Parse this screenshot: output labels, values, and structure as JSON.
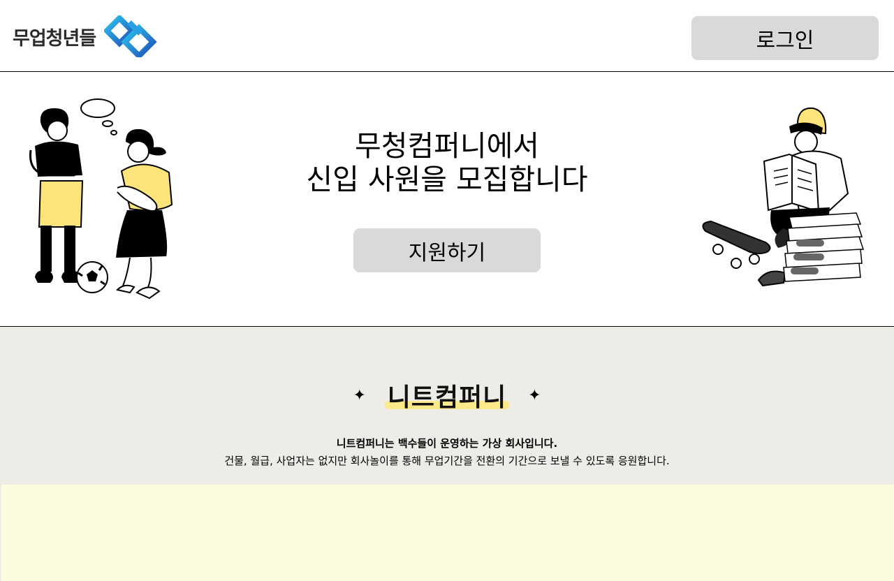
{
  "header": {
    "logo_text": "무업청년들",
    "login_label": "로그인"
  },
  "hero": {
    "title_line1": "무청컴퍼니에서",
    "title_line2": "신입 사원을 모집합니다",
    "apply_label": "지원하기"
  },
  "about": {
    "sparkle_left": "✦",
    "sparkle_right": "✦",
    "brand_name": "니트컴퍼니",
    "description_bold": "니트컴퍼니는 백수들이 운영하는 가상 회사입니다.",
    "description": "건물, 월급, 사업자는 없지만 회사놀이를 통해 무업기간을 전환의 기간으로 보낼 수 있도록 응원합니다."
  },
  "colors": {
    "button_bg": "#d9d9d9",
    "about_bg": "#eeece7",
    "highlight": "#fde98a",
    "panel_bg": "#fdfbdd",
    "logo_blue": "#1e88e5",
    "illustration_yellow": "#fde47a"
  },
  "icons": {
    "logo_mark": "diamond-chain-icon",
    "illustration_left": "two-women-with-soccer-ball",
    "illustration_right": "man-reading-newspaper-with-skateboard"
  }
}
